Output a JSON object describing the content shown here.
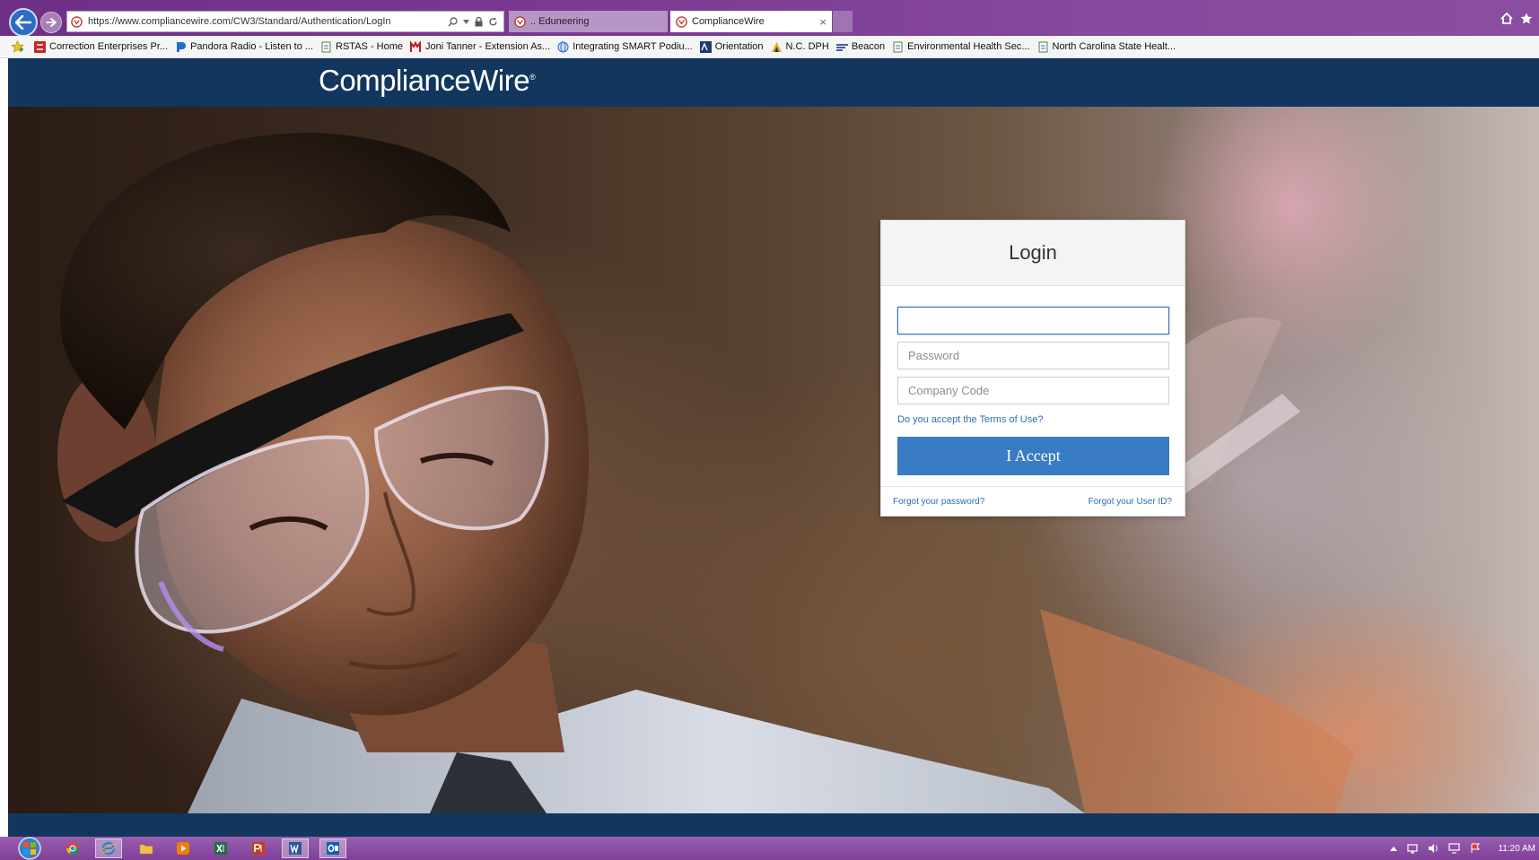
{
  "browser": {
    "url": "https://www.compliancewire.com/CW3/Standard/Authentication/LogIn",
    "tabs": [
      {
        "label": ".. Eduneering",
        "active": false
      },
      {
        "label": "ComplianceWire",
        "active": true
      }
    ],
    "tab_close": "×"
  },
  "favorites": [
    {
      "label": "Correction Enterprises  Pr...",
      "icon": "correction-enterprises-icon"
    },
    {
      "label": "Pandora Radio - Listen to ...",
      "icon": "pandora-icon"
    },
    {
      "label": "RSTAS - Home",
      "icon": "page-icon"
    },
    {
      "label": "Joni Tanner - Extension As...",
      "icon": "ncsu-icon"
    },
    {
      "label": "Integrating SMART Podiu...",
      "icon": "globe-icon"
    },
    {
      "label": "Orientation",
      "icon": "orientation-icon"
    },
    {
      "label": "N.C. DPH",
      "icon": "nc-dph-icon"
    },
    {
      "label": "Beacon",
      "icon": "beacon-icon"
    },
    {
      "label": "Environmental Health Sec...",
      "icon": "page-icon"
    },
    {
      "label": "North Carolina State Healt...",
      "icon": "page-icon"
    }
  ],
  "brand": {
    "name": "ComplianceWire",
    "reg": "®"
  },
  "login": {
    "title": "Login",
    "userid_value": "",
    "password_placeholder": "Password",
    "company_placeholder": "Company Code",
    "terms_link": "Do you accept the Terms of Use?",
    "accept_label": "I Accept",
    "forgot_password": "Forgot your password?",
    "forgot_userid": "Forgot your User ID?"
  },
  "taskbar": {
    "apps": [
      "chrome-icon",
      "internet-explorer-icon",
      "file-explorer-icon",
      "media-player-icon",
      "excel-icon",
      "powerpoint-icon",
      "word-icon",
      "outlook-icon"
    ],
    "clock": "11:20 AM"
  },
  "colors": {
    "header": "#13365e",
    "accent": "#3a7cc4",
    "link": "#2e6db4",
    "taskbar": "#7f3f98"
  }
}
